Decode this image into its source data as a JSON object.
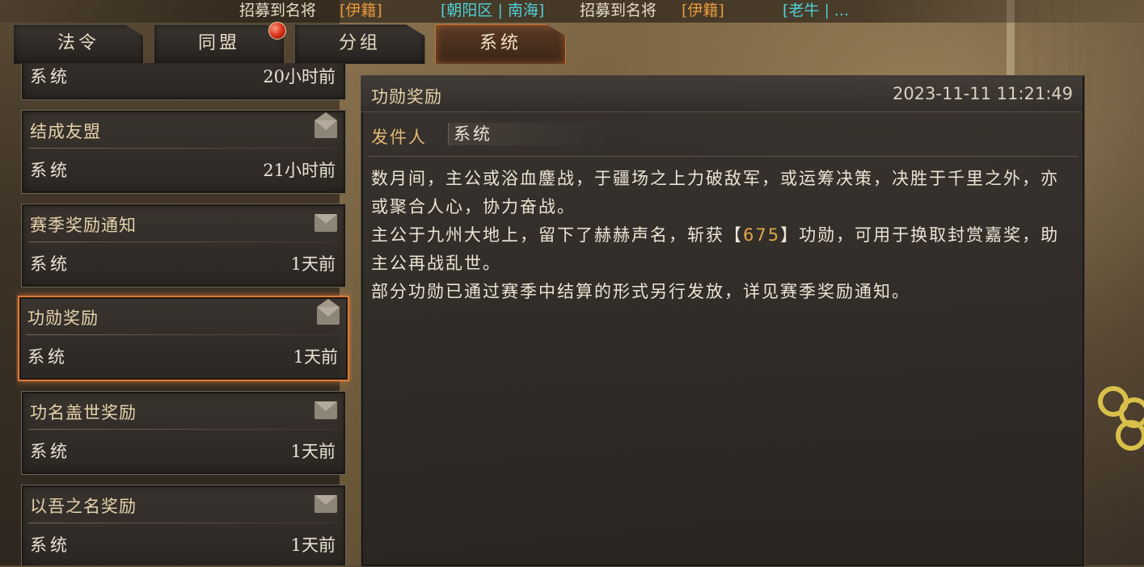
{
  "ticker": {
    "seg1": "招募到名将",
    "seg1_tag": "[伊籍]",
    "seg2_loc": "[朝阳区 | 南海]",
    "seg2": "招募到名将",
    "seg2_tag": "[伊籍]",
    "seg3_loc": "[老牛 | ..."
  },
  "tabs": [
    {
      "label": "法令"
    },
    {
      "label": "同盟"
    },
    {
      "label": "分组"
    },
    {
      "label": "系统"
    }
  ],
  "mail_list": [
    {
      "title": "",
      "sender": "系统",
      "time": "20小时前"
    },
    {
      "title": "结成友盟",
      "sender": "系统",
      "time": "21小时前"
    },
    {
      "title": "赛季奖励通知",
      "sender": "系统",
      "time": "1天前"
    },
    {
      "title": "功勋奖励",
      "sender": "系统",
      "time": "1天前"
    },
    {
      "title": "功名盖世奖励",
      "sender": "系统",
      "time": "1天前"
    },
    {
      "title": "以吾之名奖励",
      "sender": "系统",
      "time": "1天前"
    }
  ],
  "detail": {
    "title": "功勋奖励",
    "date": "2023-11-11 11:21:49",
    "sender_label": "发件人",
    "sender": "系统",
    "p1": "数月间，主公或浴血鏖战，于疆场之上力破敌军，或运筹决策，决胜于千里之外，亦或聚合人心，协力奋战。",
    "p2_a": "主公于九州大地上，留下了赫赫声名，斩获【",
    "p2_value": "675",
    "p2_b": "】功勋，可用于换取封赏嘉奖，助主公再战乱世。",
    "p3": "部分功勋已通过赛季中结算的形式另行发放，详见赛季奖励通知。"
  },
  "colors": {
    "accent": "#e07a35",
    "highlight": "#e0a64a",
    "ticker_cyan": "#4fd0d6",
    "ticker_orange": "#e69a3d"
  }
}
